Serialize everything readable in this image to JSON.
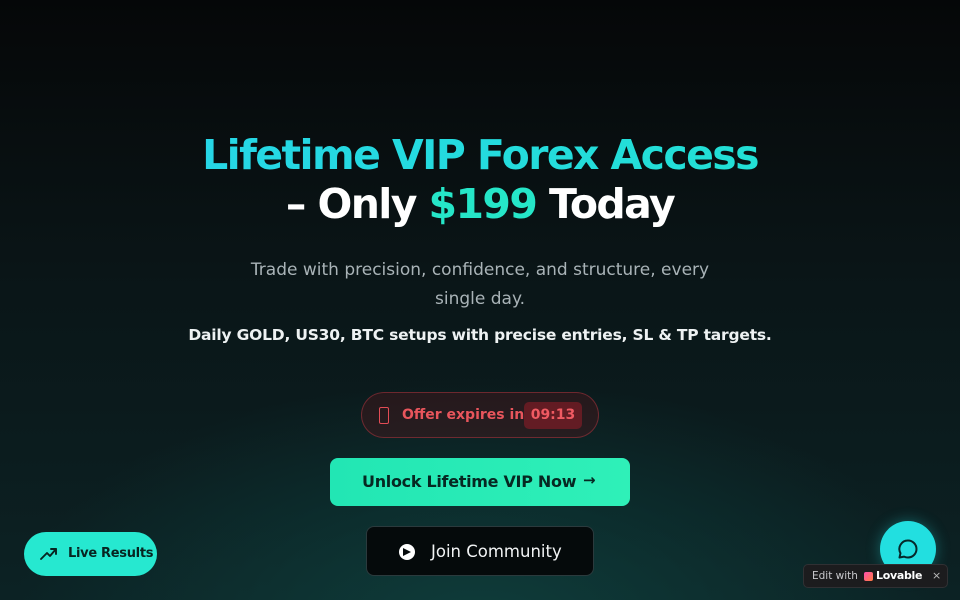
{
  "hero": {
    "title_line1": "Lifetime VIP Forex Access",
    "title_line2_prefix": "– Only ",
    "title_price": "$199",
    "title_line2_suffix": " Today",
    "subtitle": "Trade with precision, confidence, and structure, every single day.",
    "tagline": "Daily GOLD, US30, BTC setups with precise entries, SL & TP targets."
  },
  "timer": {
    "label": "Offer expires in",
    "countdown": "09:13",
    "icon": "phone-icon"
  },
  "buttons": {
    "unlock_label": "Unlock Lifetime VIP Now",
    "unlock_icon": "arrow-right-icon",
    "join_label": "Join Community",
    "join_icon": "telegram-icon",
    "live_label": "Live Results",
    "live_icon": "trending-up-icon",
    "chat_icon": "chat-bubble-icon"
  },
  "badge": {
    "edit_with": "Edit with",
    "brand": "Lovable",
    "close": "×"
  },
  "colors": {
    "accent_cyan": "#1fd6e8",
    "accent_green": "#25e6c8",
    "cta_green": "#22e6b4",
    "timer_red": "#e8555c"
  }
}
